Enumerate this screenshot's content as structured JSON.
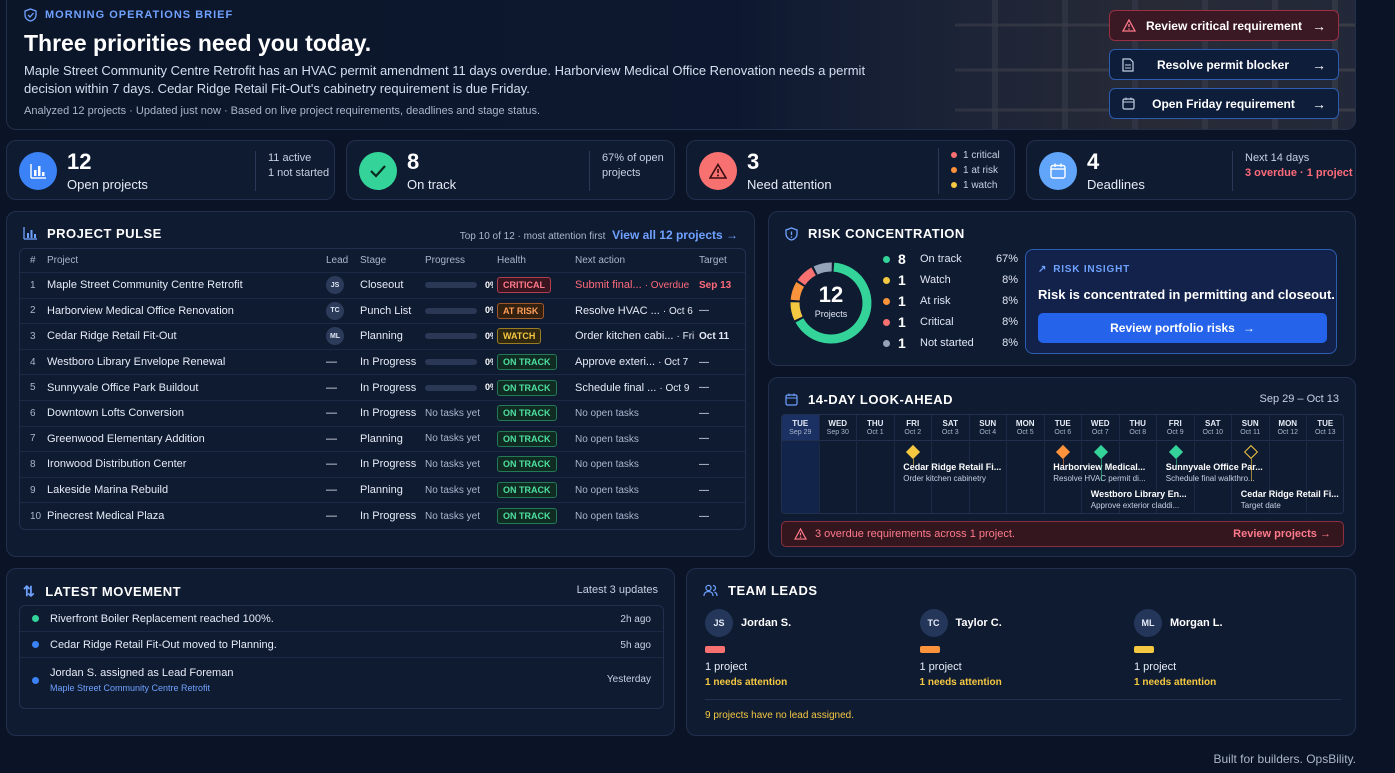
{
  "hero": {
    "eyebrow": "MORNING OPERATIONS BRIEF",
    "title": "Three priorities need you today.",
    "description": "Maple Street Community Centre Retrofit has an HVAC permit amendment 11 days overdue. Harborview Medical Office Renovation needs a permit decision within 7 days. Cedar Ridge Retail Fit-Out's cabinetry requirement is due Friday.",
    "meta": "Analyzed 12 projects  ·  Updated just now  ·  Based on live project requirements, deadlines and stage status.",
    "buttons": [
      "Review critical requirement",
      "Resolve permit blocker",
      "Open Friday requirement"
    ]
  },
  "stats": [
    {
      "value": "12",
      "label": "Open projects",
      "side": [
        "11 active",
        "1 not started"
      ],
      "icon": "bar-chart-icon",
      "color": "#3b82f6"
    },
    {
      "value": "8",
      "label": "On track",
      "side": [
        "67% of open",
        "projects"
      ],
      "icon": "check-icon",
      "color": "#34d399"
    },
    {
      "value": "3",
      "label": "Need attention",
      "side": [
        "1 critical",
        "1 at risk",
        "1 watch"
      ],
      "icon": "warning-icon",
      "color": "#f87171"
    },
    {
      "value": "4",
      "label": "Deadlines",
      "side": [
        "Next 14 days",
        "3 overdue · 1 project"
      ],
      "icon": "calendar-icon",
      "color": "#60a5fa"
    }
  ],
  "pulse": {
    "title": "PROJECT PULSE",
    "subtitle": "Top 10 of 12 · most attention first",
    "link": "View all 12 projects →",
    "headers": [
      "#",
      "Project",
      "Lead",
      "Stage",
      "Progress",
      "Health",
      "Next action",
      "Target"
    ],
    "rows": [
      {
        "n": "1",
        "project": "Maple Street Community Centre Retrofit",
        "lead": "JS",
        "stage": "Closeout",
        "progress": 0,
        "progress_text": "0%",
        "health": "CRITICAL",
        "hclass": "b-crit",
        "action": "Submit final...",
        "action_extra": "· Overdue",
        "target": "Sep 13",
        "action_red": true
      },
      {
        "n": "2",
        "project": "Harborview Medical Office Renovation",
        "lead": "TC",
        "stage": "Punch List",
        "progress": 0,
        "progress_text": "0%",
        "health": "AT RISK",
        "hclass": "b-risk",
        "action": "Resolve HVAC ...",
        "action_extra": "· Oct 6",
        "target": "—",
        "action_red": false
      },
      {
        "n": "3",
        "project": "Cedar Ridge Retail Fit-Out",
        "lead": "ML",
        "stage": "Planning",
        "progress": 0,
        "progress_text": "0%",
        "health": "WATCH",
        "hclass": "b-watch",
        "action": "Order kitchen cabi...",
        "action_extra": "· Fri",
        "target": "Oct 11",
        "action_red": false
      },
      {
        "n": "4",
        "project": "Westboro Library Envelope Renewal",
        "lead": "—",
        "stage": "In Progress",
        "progress": 0,
        "progress_text": "0%",
        "health": "ON TRACK",
        "hclass": "b-ok",
        "action": "Approve exteri...",
        "action_extra": "· Oct 7",
        "target": "—",
        "action_red": false
      },
      {
        "n": "5",
        "project": "Sunnyvale Office Park Buildout",
        "lead": "—",
        "stage": "In Progress",
        "progress": 0,
        "progress_text": "0%",
        "health": "ON TRACK",
        "hclass": "b-ok",
        "action": "Schedule final ...",
        "action_extra": "· Oct 9",
        "target": "—",
        "action_red": false
      },
      {
        "n": "6",
        "project": "Downtown Lofts Conversion",
        "lead": "—",
        "stage": "In Progress",
        "progress": null,
        "progress_text": "No tasks yet",
        "health": "ON TRACK",
        "hclass": "b-ok",
        "action": "No open tasks",
        "action_extra": "",
        "target": "—",
        "action_red": false
      },
      {
        "n": "7",
        "project": "Greenwood Elementary Addition",
        "lead": "—",
        "stage": "Planning",
        "progress": null,
        "progress_text": "No tasks yet",
        "health": "ON TRACK",
        "hclass": "b-ok",
        "action": "No open tasks",
        "action_extra": "",
        "target": "—",
        "action_red": false
      },
      {
        "n": "8",
        "project": "Ironwood Distribution Center",
        "lead": "—",
        "stage": "In Progress",
        "progress": null,
        "progress_text": "No tasks yet",
        "health": "ON TRACK",
        "hclass": "b-ok",
        "action": "No open tasks",
        "action_extra": "",
        "target": "—",
        "action_red": false
      },
      {
        "n": "9",
        "project": "Lakeside Marina Rebuild",
        "lead": "—",
        "stage": "Planning",
        "progress": null,
        "progress_text": "No tasks yet",
        "health": "ON TRACK",
        "hclass": "b-ok",
        "action": "No open tasks",
        "action_extra": "",
        "target": "—",
        "action_red": false
      },
      {
        "n": "10",
        "project": "Pinecrest Medical Plaza",
        "lead": "—",
        "stage": "In Progress",
        "progress": null,
        "progress_text": "No tasks yet",
        "health": "ON TRACK",
        "hclass": "b-ok",
        "action": "No open tasks",
        "action_extra": "",
        "target": "—",
        "action_red": false
      }
    ]
  },
  "risk": {
    "title": "RISK CONCENTRATION",
    "total": "12",
    "total_label": "Projects",
    "legend": [
      {
        "count": "8",
        "label": "On track",
        "pct": "67%",
        "color": "#34d399"
      },
      {
        "count": "1",
        "label": "Watch",
        "pct": "8%",
        "color": "#f5c842"
      },
      {
        "count": "1",
        "label": "At risk",
        "pct": "8%",
        "color": "#fb923c"
      },
      {
        "count": "1",
        "label": "Critical",
        "pct": "8%",
        "color": "#f87171"
      },
      {
        "count": "1",
        "label": "Not started",
        "pct": "8%",
        "color": "#94a3b8"
      }
    ],
    "insight_heading": "RISK INSIGHT",
    "insight_text": "Risk is concentrated in permitting and closeout.",
    "insight_button": "Review portfolio risks"
  },
  "look": {
    "title": "14-DAY LOOK-AHEAD",
    "range": "Sep 29 – Oct 13",
    "days": [
      {
        "w": "TUE",
        "d": "Sep 29"
      },
      {
        "w": "WED",
        "d": "Sep 30"
      },
      {
        "w": "THU",
        "d": "Oct 1"
      },
      {
        "w": "FRI",
        "d": "Oct 2"
      },
      {
        "w": "SAT",
        "d": "Oct 3"
      },
      {
        "w": "SUN",
        "d": "Oct 4"
      },
      {
        "w": "MON",
        "d": "Oct 5"
      },
      {
        "w": "TUE",
        "d": "Oct 6"
      },
      {
        "w": "WED",
        "d": "Oct 7"
      },
      {
        "w": "THU",
        "d": "Oct 8"
      },
      {
        "w": "FRI",
        "d": "Oct 9"
      },
      {
        "w": "SAT",
        "d": "Oct 10"
      },
      {
        "w": "SUN",
        "d": "Oct 11"
      },
      {
        "w": "MON",
        "d": "Oct 12"
      },
      {
        "w": "TUE",
        "d": "Oct 13"
      }
    ],
    "events": [
      {
        "title": "Cedar Ridge Retail Fi...",
        "sub": "Order kitchen cabinetry",
        "day": 3,
        "lane": 0,
        "color": "#f5c842",
        "hollow": false
      },
      {
        "title": "Harborview Medical...",
        "sub": "Resolve HVAC permit di...",
        "day": 7,
        "lane": 0,
        "color": "#fb923c",
        "hollow": false
      },
      {
        "title": "Westboro Library En...",
        "sub": "Approve exterior claddi...",
        "day": 8,
        "lane": 1,
        "color": "#34d399",
        "hollow": false
      },
      {
        "title": "Sunnyvale Office Par...",
        "sub": "Schedule final walkthro...",
        "day": 10,
        "lane": 0,
        "color": "#34d399",
        "hollow": false
      },
      {
        "title": "Cedar Ridge Retail Fi...",
        "sub": "Target date",
        "day": 12,
        "lane": 1,
        "color": "#f5c842",
        "hollow": true
      }
    ],
    "alert": "3 overdue requirements across 1 project.",
    "alert_link": "Review projects →"
  },
  "movement": {
    "title": "LATEST MOVEMENT",
    "right": "Latest 3 updates",
    "items": [
      {
        "text": "Riverfront Boiler Replacement reached 100%.",
        "sub": "",
        "time": "2h ago",
        "color": "#34d399"
      },
      {
        "text": "Cedar Ridge Retail Fit-Out moved to Planning.",
        "sub": "",
        "time": "5h ago",
        "color": "#3b82f6"
      },
      {
        "text": "Jordan S. assigned as Lead Foreman",
        "sub": "Maple Street Community Centre Retrofit",
        "time": "Yesterday",
        "color": "#3b82f6"
      }
    ]
  },
  "team": {
    "title": "TEAM LEADS",
    "leads": [
      {
        "initials": "JS",
        "name": "Jordan S.",
        "bar_color": "#f87171",
        "projects": "1 project",
        "attention": "1 needs attention"
      },
      {
        "initials": "TC",
        "name": "Taylor C.",
        "bar_color": "#fb923c",
        "projects": "1 project",
        "attention": "1 needs attention"
      },
      {
        "initials": "ML",
        "name": "Morgan L.",
        "bar_color": "#f5c842",
        "projects": "1 project",
        "attention": "1 needs attention"
      }
    ],
    "footer": "9 projects have no lead assigned."
  },
  "footer": "Built for builders. OpsBility."
}
